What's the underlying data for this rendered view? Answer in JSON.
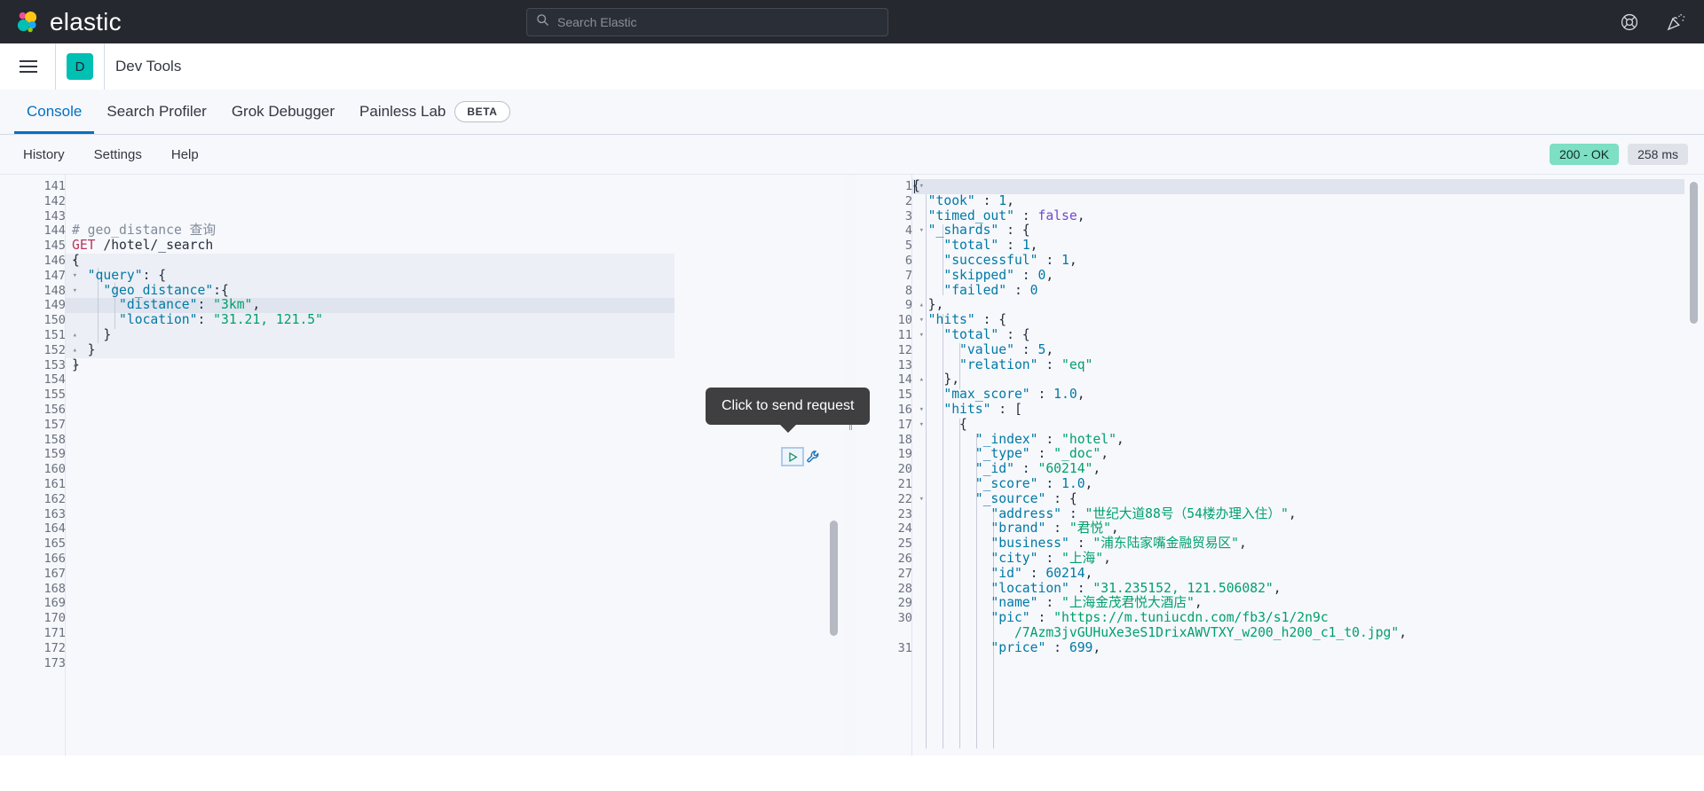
{
  "header": {
    "brand": "elastic",
    "logo_icon": "elastic-logo-icon",
    "search": {
      "placeholder": "Search Elastic",
      "value": "",
      "icon": "search-icon"
    },
    "help_icon": "lifebuoy-help-icon",
    "whatsnew_icon": "confetti-announcement-icon"
  },
  "breadcrumb": {
    "menu_icon": "hamburger-menu-icon",
    "app_badge": "D",
    "title": "Dev Tools"
  },
  "tabs": [
    {
      "label": "Console",
      "active": true,
      "badge": ""
    },
    {
      "label": "Search Profiler",
      "active": false,
      "badge": ""
    },
    {
      "label": "Grok Debugger",
      "active": false,
      "badge": ""
    },
    {
      "label": "Painless Lab",
      "active": false,
      "badge": "BETA"
    }
  ],
  "console_toolbar": {
    "buttons": [
      "History",
      "Settings",
      "Help"
    ],
    "status_code": "200 - OK",
    "status_time": "258 ms",
    "status_color": "#7ddfc3"
  },
  "tooltip": {
    "text": "Click to send request"
  },
  "actions": {
    "play_icon": "play-send-request-icon",
    "wrench_icon": "wrench-options-icon"
  },
  "editor": {
    "first_line": 141,
    "last_line": 173,
    "cursor_line": 149,
    "selection_from": 146,
    "selection_to": 153,
    "fold_lines": [
      146,
      147,
      148
    ],
    "unfold_lines": [
      151,
      152,
      153
    ],
    "lines": [
      {
        "n": 141,
        "tokens": []
      },
      {
        "n": 142,
        "tokens": []
      },
      {
        "n": 143,
        "tokens": []
      },
      {
        "n": 144,
        "tokens": [
          {
            "t": "comment",
            "s": "# geo_distance 查询"
          }
        ]
      },
      {
        "n": 145,
        "tokens": [
          {
            "t": "method",
            "s": "GET"
          },
          {
            "t": "url",
            "s": " /hotel/_search"
          }
        ]
      },
      {
        "n": 146,
        "tokens": [
          {
            "t": "punct",
            "s": "{"
          }
        ]
      },
      {
        "n": 147,
        "tokens": [
          {
            "t": "key",
            "s": "  \"query\""
          },
          {
            "t": "punct",
            "s": ": {"
          }
        ]
      },
      {
        "n": 148,
        "tokens": [
          {
            "t": "key",
            "s": "    \"geo_distance\""
          },
          {
            "t": "punct",
            "s": ":{"
          }
        ]
      },
      {
        "n": 149,
        "tokens": [
          {
            "t": "key",
            "s": "      \"distance\""
          },
          {
            "t": "punct",
            "s": ": "
          },
          {
            "t": "string",
            "s": "\"3km\""
          },
          {
            "t": "punct",
            "s": ","
          }
        ]
      },
      {
        "n": 150,
        "tokens": [
          {
            "t": "key",
            "s": "      \"location\""
          },
          {
            "t": "punct",
            "s": ": "
          },
          {
            "t": "string",
            "s": "\"31.21, 121.5\""
          }
        ]
      },
      {
        "n": 151,
        "tokens": [
          {
            "t": "punct",
            "s": "    }"
          }
        ]
      },
      {
        "n": 152,
        "tokens": [
          {
            "t": "punct",
            "s": "  }"
          }
        ]
      },
      {
        "n": 153,
        "tokens": [
          {
            "t": "punct",
            "s": "}"
          }
        ]
      },
      {
        "n": 154,
        "tokens": []
      },
      {
        "n": 155,
        "tokens": []
      },
      {
        "n": 156,
        "tokens": []
      },
      {
        "n": 157,
        "tokens": []
      },
      {
        "n": 158,
        "tokens": []
      },
      {
        "n": 159,
        "tokens": []
      },
      {
        "n": 160,
        "tokens": []
      },
      {
        "n": 161,
        "tokens": []
      },
      {
        "n": 162,
        "tokens": []
      },
      {
        "n": 163,
        "tokens": []
      },
      {
        "n": 164,
        "tokens": []
      },
      {
        "n": 165,
        "tokens": []
      },
      {
        "n": 166,
        "tokens": []
      },
      {
        "n": 167,
        "tokens": []
      },
      {
        "n": 168,
        "tokens": []
      },
      {
        "n": 169,
        "tokens": []
      },
      {
        "n": 170,
        "tokens": []
      },
      {
        "n": 171,
        "tokens": []
      },
      {
        "n": 172,
        "tokens": []
      },
      {
        "n": 173,
        "tokens": []
      }
    ]
  },
  "response": {
    "first_line": 1,
    "last_line": 31,
    "fold_lines": [
      1,
      4,
      10,
      11,
      16,
      17,
      22
    ],
    "unfold_lines": [
      9,
      14
    ],
    "lines": [
      {
        "n": 1,
        "tokens": [
          {
            "t": "punct",
            "s": "{"
          }
        ]
      },
      {
        "n": 2,
        "tokens": [
          {
            "t": "key",
            "s": "  \"took\""
          },
          {
            "t": "punct",
            "s": " : "
          },
          {
            "t": "num",
            "s": "1"
          },
          {
            "t": "punct",
            "s": ","
          }
        ]
      },
      {
        "n": 3,
        "tokens": [
          {
            "t": "key",
            "s": "  \"timed_out\""
          },
          {
            "t": "punct",
            "s": " : "
          },
          {
            "t": "bool",
            "s": "false"
          },
          {
            "t": "punct",
            "s": ","
          }
        ]
      },
      {
        "n": 4,
        "tokens": [
          {
            "t": "key",
            "s": "  \"_shards\""
          },
          {
            "t": "punct",
            "s": " : {"
          }
        ]
      },
      {
        "n": 5,
        "tokens": [
          {
            "t": "key",
            "s": "    \"total\""
          },
          {
            "t": "punct",
            "s": " : "
          },
          {
            "t": "num",
            "s": "1"
          },
          {
            "t": "punct",
            "s": ","
          }
        ]
      },
      {
        "n": 6,
        "tokens": [
          {
            "t": "key",
            "s": "    \"successful\""
          },
          {
            "t": "punct",
            "s": " : "
          },
          {
            "t": "num",
            "s": "1"
          },
          {
            "t": "punct",
            "s": ","
          }
        ]
      },
      {
        "n": 7,
        "tokens": [
          {
            "t": "key",
            "s": "    \"skipped\""
          },
          {
            "t": "punct",
            "s": " : "
          },
          {
            "t": "num",
            "s": "0"
          },
          {
            "t": "punct",
            "s": ","
          }
        ]
      },
      {
        "n": 8,
        "tokens": [
          {
            "t": "key",
            "s": "    \"failed\""
          },
          {
            "t": "punct",
            "s": " : "
          },
          {
            "t": "num",
            "s": "0"
          }
        ]
      },
      {
        "n": 9,
        "tokens": [
          {
            "t": "punct",
            "s": "  },"
          }
        ]
      },
      {
        "n": 10,
        "tokens": [
          {
            "t": "key",
            "s": "  \"hits\""
          },
          {
            "t": "punct",
            "s": " : {"
          }
        ]
      },
      {
        "n": 11,
        "tokens": [
          {
            "t": "key",
            "s": "    \"total\""
          },
          {
            "t": "punct",
            "s": " : {"
          }
        ]
      },
      {
        "n": 12,
        "tokens": [
          {
            "t": "key",
            "s": "      \"value\""
          },
          {
            "t": "punct",
            "s": " : "
          },
          {
            "t": "num",
            "s": "5"
          },
          {
            "t": "punct",
            "s": ","
          }
        ]
      },
      {
        "n": 13,
        "tokens": [
          {
            "t": "key",
            "s": "      \"relation\""
          },
          {
            "t": "punct",
            "s": " : "
          },
          {
            "t": "string",
            "s": "\"eq\""
          }
        ]
      },
      {
        "n": 14,
        "tokens": [
          {
            "t": "punct",
            "s": "    },"
          }
        ]
      },
      {
        "n": 15,
        "tokens": [
          {
            "t": "key",
            "s": "    \"max_score\""
          },
          {
            "t": "punct",
            "s": " : "
          },
          {
            "t": "num",
            "s": "1.0"
          },
          {
            "t": "punct",
            "s": ","
          }
        ]
      },
      {
        "n": 16,
        "tokens": [
          {
            "t": "key",
            "s": "    \"hits\""
          },
          {
            "t": "punct",
            "s": " : ["
          }
        ]
      },
      {
        "n": 17,
        "tokens": [
          {
            "t": "punct",
            "s": "      {"
          }
        ]
      },
      {
        "n": 18,
        "tokens": [
          {
            "t": "key",
            "s": "        \"_index\""
          },
          {
            "t": "punct",
            "s": " : "
          },
          {
            "t": "string",
            "s": "\"hotel\""
          },
          {
            "t": "punct",
            "s": ","
          }
        ]
      },
      {
        "n": 19,
        "tokens": [
          {
            "t": "key",
            "s": "        \"_type\""
          },
          {
            "t": "punct",
            "s": " : "
          },
          {
            "t": "string",
            "s": "\"_doc\""
          },
          {
            "t": "punct",
            "s": ","
          }
        ]
      },
      {
        "n": 20,
        "tokens": [
          {
            "t": "key",
            "s": "        \"_id\""
          },
          {
            "t": "punct",
            "s": " : "
          },
          {
            "t": "string",
            "s": "\"60214\""
          },
          {
            "t": "punct",
            "s": ","
          }
        ]
      },
      {
        "n": 21,
        "tokens": [
          {
            "t": "key",
            "s": "        \"_score\""
          },
          {
            "t": "punct",
            "s": " : "
          },
          {
            "t": "num",
            "s": "1.0"
          },
          {
            "t": "punct",
            "s": ","
          }
        ]
      },
      {
        "n": 22,
        "tokens": [
          {
            "t": "key",
            "s": "        \"_source\""
          },
          {
            "t": "punct",
            "s": " : {"
          }
        ]
      },
      {
        "n": 23,
        "tokens": [
          {
            "t": "key",
            "s": "          \"address\""
          },
          {
            "t": "punct",
            "s": " : "
          },
          {
            "t": "string",
            "s": "\"世纪大道88号（54楼办理入住）\""
          },
          {
            "t": "punct",
            "s": ","
          }
        ]
      },
      {
        "n": 24,
        "tokens": [
          {
            "t": "key",
            "s": "          \"brand\""
          },
          {
            "t": "punct",
            "s": " : "
          },
          {
            "t": "string",
            "s": "\"君悦\""
          },
          {
            "t": "punct",
            "s": ","
          }
        ]
      },
      {
        "n": 25,
        "tokens": [
          {
            "t": "key",
            "s": "          \"business\""
          },
          {
            "t": "punct",
            "s": " : "
          },
          {
            "t": "string",
            "s": "\"浦东陆家嘴金融贸易区\""
          },
          {
            "t": "punct",
            "s": ","
          }
        ]
      },
      {
        "n": 26,
        "tokens": [
          {
            "t": "key",
            "s": "          \"city\""
          },
          {
            "t": "punct",
            "s": " : "
          },
          {
            "t": "string",
            "s": "\"上海\""
          },
          {
            "t": "punct",
            "s": ","
          }
        ]
      },
      {
        "n": 27,
        "tokens": [
          {
            "t": "key",
            "s": "          \"id\""
          },
          {
            "t": "punct",
            "s": " : "
          },
          {
            "t": "num",
            "s": "60214"
          },
          {
            "t": "punct",
            "s": ","
          }
        ]
      },
      {
        "n": 28,
        "tokens": [
          {
            "t": "key",
            "s": "          \"location\""
          },
          {
            "t": "punct",
            "s": " : "
          },
          {
            "t": "string",
            "s": "\"31.235152, 121.506082\""
          },
          {
            "t": "punct",
            "s": ","
          }
        ]
      },
      {
        "n": 29,
        "tokens": [
          {
            "t": "key",
            "s": "          \"name\""
          },
          {
            "t": "punct",
            "s": " : "
          },
          {
            "t": "string",
            "s": "\"上海金茂君悦大酒店\""
          },
          {
            "t": "punct",
            "s": ","
          }
        ]
      },
      {
        "n": 30,
        "tokens": [
          {
            "t": "key",
            "s": "          \"pic\""
          },
          {
            "t": "punct",
            "s": " : "
          },
          {
            "t": "string",
            "s": "\"https://m.tuniucdn.com/fb3/s1/2n9c"
          }
        ]
      },
      {
        "n": null,
        "tokens": [
          {
            "t": "string",
            "s": "             /7Azm3jvGUHuXe3eS1DrixAWVTXY_w200_h200_c1_t0.jpg\""
          },
          {
            "t": "punct",
            "s": ","
          }
        ]
      },
      {
        "n": 31,
        "tokens": [
          {
            "t": "key",
            "s": "          \"price\""
          },
          {
            "t": "punct",
            "s": " : "
          },
          {
            "t": "num",
            "s": "699"
          },
          {
            "t": "punct",
            "s": ","
          }
        ]
      }
    ]
  }
}
